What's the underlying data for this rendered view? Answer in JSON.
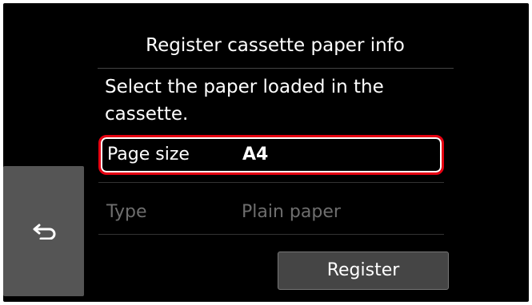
{
  "header": {
    "title": "Register cassette paper info"
  },
  "instruction": {
    "text": "Select the paper loaded in the cassette."
  },
  "settings": [
    {
      "label": "Page size",
      "value": "A4",
      "selected": true
    },
    {
      "label": "Type",
      "value": "Plain paper",
      "selected": false
    }
  ],
  "actions": {
    "register_label": "Register",
    "back_icon": "return-arrow-icon"
  },
  "colors": {
    "screen_background": "#000000",
    "selection_border": "#e60012",
    "disabled_text": "#6e6e6e",
    "button_background": "#454545",
    "back_button_background": "#555555"
  }
}
